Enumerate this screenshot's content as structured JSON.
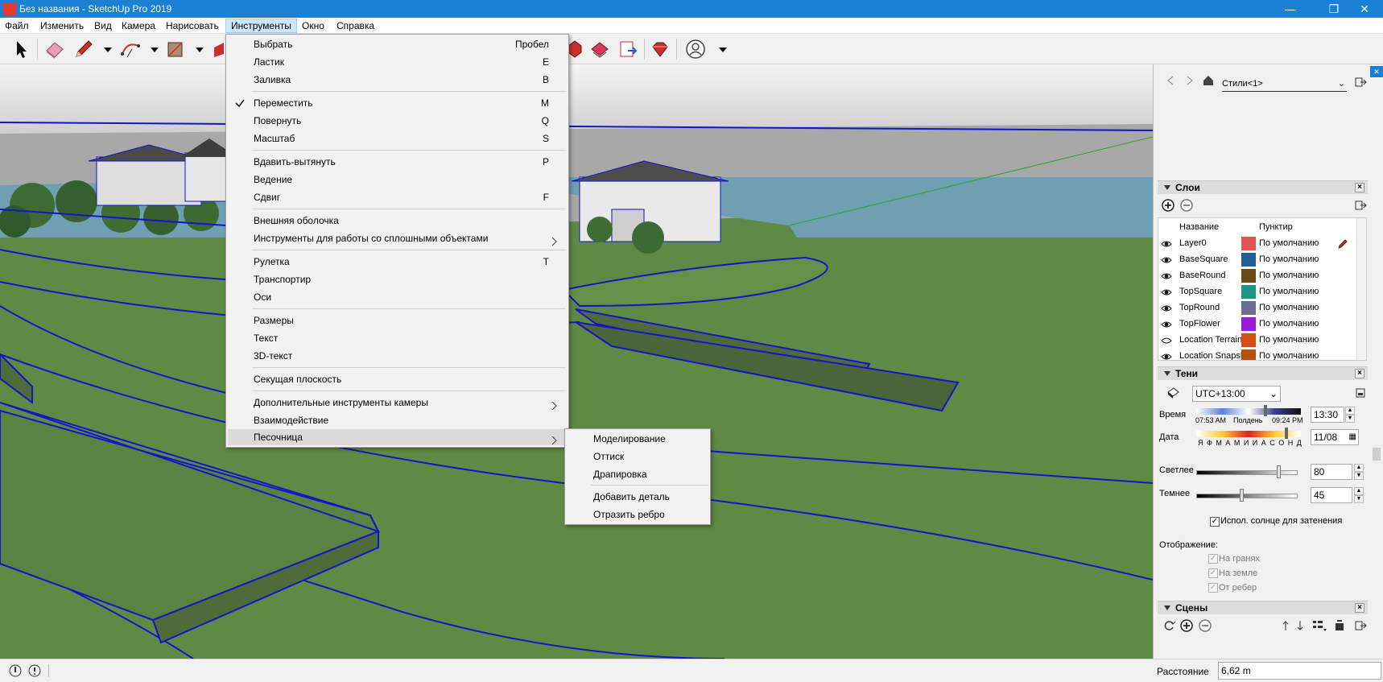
{
  "window": {
    "title": "Без названия - SketchUp Pro 2019",
    "controls": [
      "minimize-icon",
      "maximize-icon",
      "close-icon"
    ]
  },
  "menubar": {
    "items": [
      "Файл",
      "Изменить",
      "Вид",
      "Камера",
      "Нарисовать",
      "Инструменты",
      "Окно",
      "Справка"
    ],
    "active": "Инструменты"
  },
  "toolbar": {
    "tools": [
      "select-icon",
      "eraser-icon",
      "pencil-icon",
      "arc-icon",
      "rectangle-icon",
      "push-pull-icon",
      "ruby-icon",
      "extension-warehouse-icon",
      "send-layout-icon",
      "gem-icon",
      "account-icon"
    ]
  },
  "tools_menu": {
    "items": [
      {
        "label": "Выбрать",
        "key": "Пробел"
      },
      {
        "label": "Ластик",
        "key": "E"
      },
      {
        "label": "Заливка",
        "key": "B"
      },
      {
        "label": "Переместить",
        "key": "M",
        "checked": true
      },
      {
        "label": "Повернуть",
        "key": "Q"
      },
      {
        "label": "Масштаб",
        "key": "S"
      },
      {
        "label": "Вдавить-вытянуть",
        "key": "P"
      },
      {
        "label": "Ведение",
        "key": ""
      },
      {
        "label": "Сдвиг",
        "key": "F"
      },
      {
        "label": "Внешняя оболочка",
        "key": ""
      },
      {
        "label": "Инструменты для работы со сплошными объектами",
        "key": "",
        "submenu": true
      },
      {
        "label": "Рулетка",
        "key": "T"
      },
      {
        "label": "Транспортир",
        "key": ""
      },
      {
        "label": "Оси",
        "key": ""
      },
      {
        "label": "Размеры",
        "key": ""
      },
      {
        "label": "Текст",
        "key": ""
      },
      {
        "label": "3D-текст",
        "key": ""
      },
      {
        "label": "Секущая плоскость",
        "key": ""
      },
      {
        "label": "Дополнительные инструменты камеры",
        "key": "",
        "submenu": true
      },
      {
        "label": "Взаимодействие",
        "key": ""
      },
      {
        "label": "Песочница",
        "key": "",
        "submenu": true,
        "highlighted": true
      }
    ]
  },
  "sandbox_submenu": {
    "items": [
      "Моделирование",
      "Оттиск",
      "Драпировка",
      "Добавить деталь",
      "Отразить ребро"
    ]
  },
  "styles_panel": {
    "style_name": "Стили<1>"
  },
  "layers_panel": {
    "title": "Слои",
    "col_name": "Название",
    "col_dash": "Пунктир",
    "rows": [
      {
        "name": "Layer0",
        "color": "#e2544f",
        "dash": "По умолчанию",
        "visible": true
      },
      {
        "name": "BaseSquare",
        "color": "#1f5f93",
        "dash": "По умолчанию",
        "visible": true
      },
      {
        "name": "BaseRound",
        "color": "#6b4a16",
        "dash": "По умолчанию",
        "visible": true
      },
      {
        "name": "TopSquare",
        "color": "#1d9688",
        "dash": "По умолчанию",
        "visible": true
      },
      {
        "name": "TopRound",
        "color": "#6c6e90",
        "dash": "По умолчанию",
        "visible": true
      },
      {
        "name": "TopFlower",
        "color": "#9a1ad8",
        "dash": "По умолчанию",
        "visible": true
      },
      {
        "name": "Location Terrain",
        "color": "#d64e17",
        "dash": "По умолчанию",
        "visible": false
      },
      {
        "name": "Location Snapshot",
        "color": "#b5500f",
        "dash": "По умолчанию",
        "visible": true
      }
    ]
  },
  "shadows_panel": {
    "title": "Тени",
    "timezone": "UTC+13:00",
    "time_label": "Время",
    "time_start": "07:53 AM",
    "time_mid": "Полдень",
    "time_end": "09:24 PM",
    "time_value": "13:30",
    "date_label": "Дата",
    "months": "Я Ф М А М И И А С О Н Д",
    "date_value": "11/08",
    "light_label": "Светлее",
    "light_value": "80",
    "dark_label": "Темнее",
    "dark_value": "45",
    "use_sun_label": "Испол. солнце для затенения",
    "display_label": "Отображение:",
    "on_faces": "На гранях",
    "on_ground": "На земле",
    "from_edges": "От ребер"
  },
  "scenes_panel": {
    "title": "Сцены"
  },
  "statusbar": {
    "measure_label": "Расстояние",
    "measure_value": "6,62 m"
  }
}
